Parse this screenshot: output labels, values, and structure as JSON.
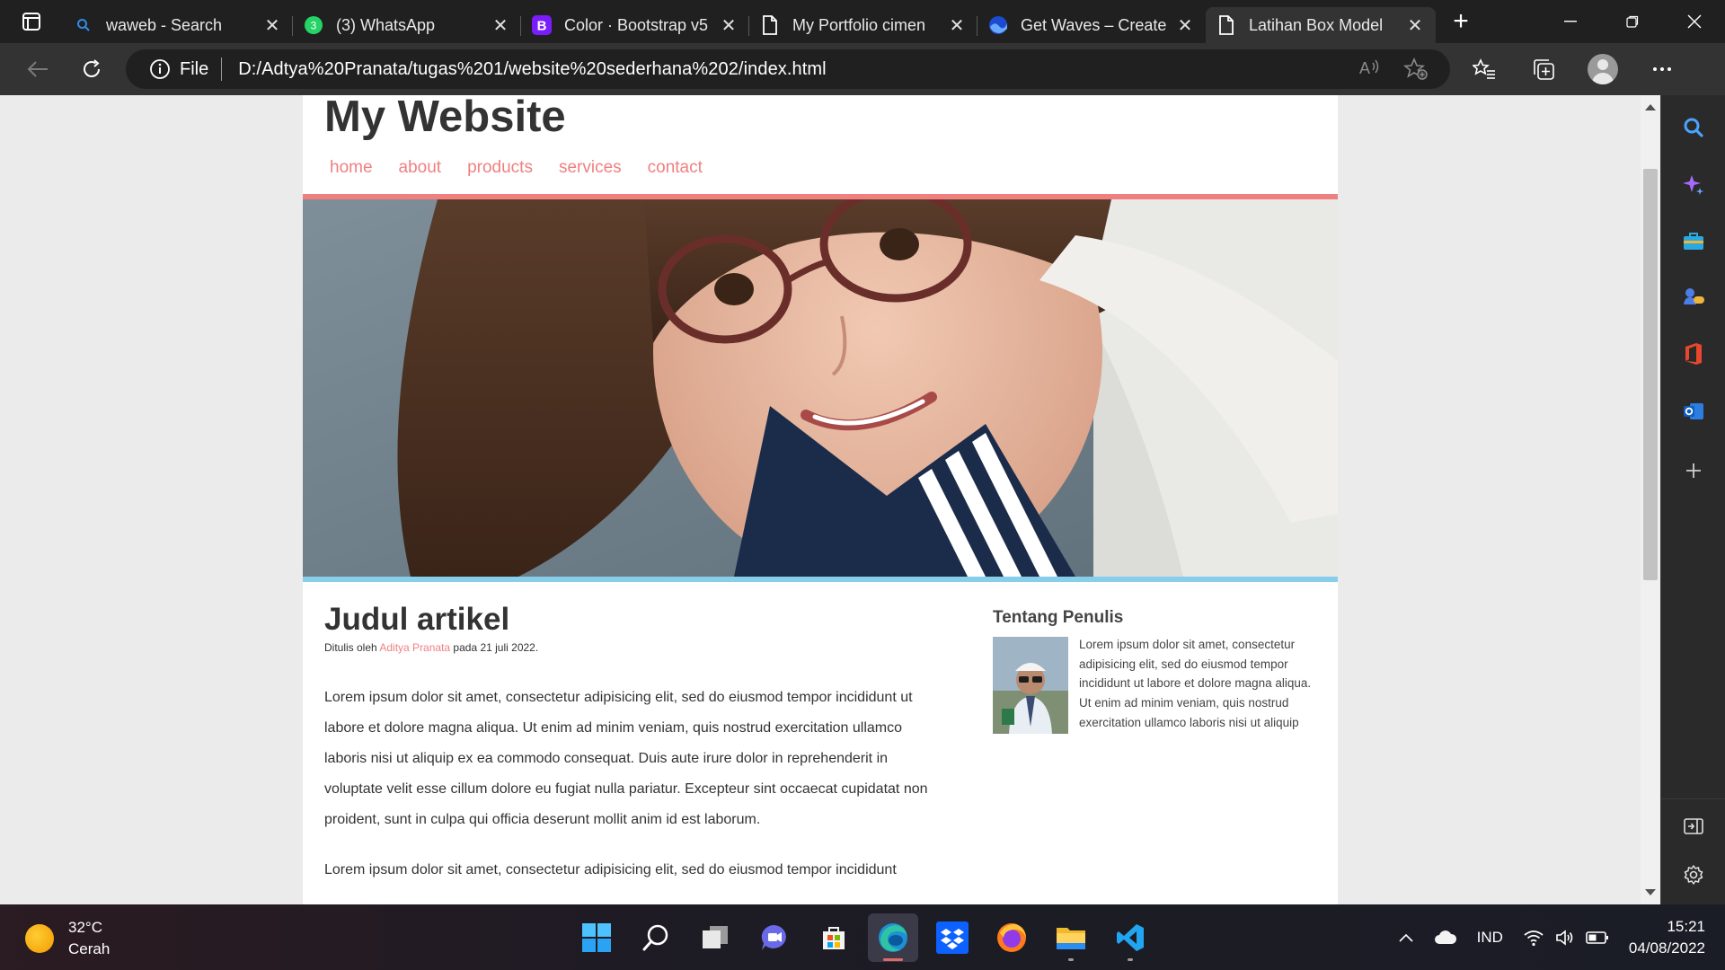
{
  "browser": {
    "tabs": [
      {
        "title": "waweb - Search",
        "icon": "search-icon"
      },
      {
        "title": "(3) WhatsApp",
        "icon": "whatsapp-icon",
        "badge": "3"
      },
      {
        "title": "Color · Bootstrap v5",
        "icon": "bootstrap-icon",
        "badge": "B"
      },
      {
        "title": "My Portfolio cimen",
        "icon": "page-icon"
      },
      {
        "title": "Get Waves – Create",
        "icon": "waves-icon"
      },
      {
        "title": "Latihan Box Model",
        "icon": "page-icon",
        "active": true
      }
    ],
    "address": {
      "scheme_label": "File",
      "url": "D:/Adtya%20Pranata/tugas%201/website%20sederhana%202/index.html"
    }
  },
  "site": {
    "title": "My Website",
    "nav": [
      "home",
      "about",
      "products",
      "services",
      "contact"
    ],
    "article": {
      "title": "Judul artikel",
      "byline_prefix": "Ditulis oleh ",
      "author": "Aditya Pranata",
      "byline_suffix": " pada 21 juli 2022.",
      "paragraphs": [
        "Lorem ipsum dolor sit amet, consectetur adipisicing elit, sed do eiusmod tempor incididunt ut labore et dolore magna aliqua. Ut enim ad minim veniam, quis nostrud exercitation ullamco laboris nisi ut aliquip ex ea commodo consequat. Duis aute irure dolor in reprehenderit in voluptate velit esse cillum dolore eu fugiat nulla pariatur. Excepteur sint occaecat cupidatat non proident, sunt in culpa qui officia deserunt mollit anim id est laborum.",
        "Lorem ipsum dolor sit amet, consectetur adipisicing elit, sed do eiusmod tempor incididunt"
      ]
    },
    "aside": {
      "title": "Tentang Penulis",
      "bio": "Lorem ipsum dolor sit amet, consectetur adipisicing elit, sed do eiusmod tempor incididunt ut labore et dolore magna aliqua. Ut enim ad minim veniam, quis nostrud exercitation ullamco laboris nisi ut aliquip"
    }
  },
  "taskbar": {
    "weather": {
      "temp": "32°C",
      "condition": "Cerah"
    },
    "apps": [
      "start-icon",
      "search-icon",
      "task-view-icon",
      "teams-chat-icon",
      "store-icon",
      "edge-icon",
      "dropbox-icon",
      "firefox-icon",
      "file-explorer-icon",
      "vscode-icon"
    ],
    "language": "IND",
    "time": "15:21",
    "date": "04/08/2022"
  },
  "colors": {
    "accent_link": "#f08080",
    "hero_bottom_border": "#87ceeb",
    "browser_dark": "#202020"
  }
}
